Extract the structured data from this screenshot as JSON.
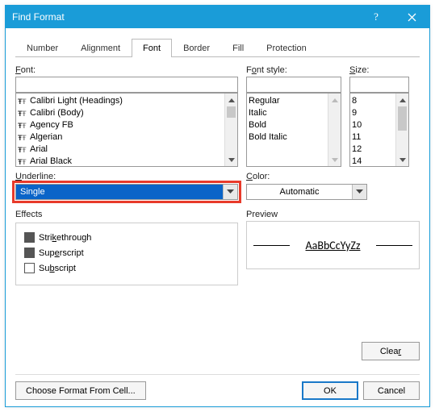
{
  "title": "Find Format",
  "tabs": [
    "Number",
    "Alignment",
    "Font",
    "Border",
    "Fill",
    "Protection"
  ],
  "active_tab_index": 2,
  "labels": {
    "font": "Font:",
    "font_style": "Font style:",
    "size": "Size:",
    "underline": "Underline:",
    "color": "Color:",
    "effects": "Effects",
    "preview": "Preview"
  },
  "font_list": [
    "Calibri Light (Headings)",
    "Calibri (Body)",
    "Agency FB",
    "Algerian",
    "Arial",
    "Arial Black"
  ],
  "font_style_list": [
    "Regular",
    "Italic",
    "Bold",
    "Bold Italic"
  ],
  "size_list": [
    "8",
    "9",
    "10",
    "11",
    "12",
    "14"
  ],
  "underline": {
    "value": "Single"
  },
  "color": {
    "value": "Automatic"
  },
  "effects": {
    "strikethrough": "Strikethrough",
    "superscript": "Superscript",
    "subscript": "Subscript"
  },
  "preview_text": "AaBbCcYyZz",
  "buttons": {
    "clear": "Clear",
    "choose_format": "Choose Format From Cell...",
    "ok": "OK",
    "cancel": "Cancel"
  }
}
